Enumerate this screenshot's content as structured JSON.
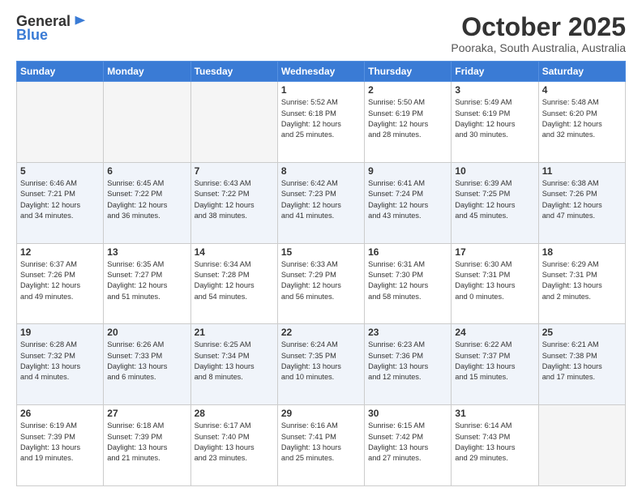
{
  "logo": {
    "general": "General",
    "blue": "Blue"
  },
  "header": {
    "month": "October 2025",
    "location": "Pooraka, South Australia, Australia"
  },
  "weekdays": [
    "Sunday",
    "Monday",
    "Tuesday",
    "Wednesday",
    "Thursday",
    "Friday",
    "Saturday"
  ],
  "weeks": [
    [
      {
        "day": "",
        "info": ""
      },
      {
        "day": "",
        "info": ""
      },
      {
        "day": "",
        "info": ""
      },
      {
        "day": "1",
        "info": "Sunrise: 5:52 AM\nSunset: 6:18 PM\nDaylight: 12 hours\nand 25 minutes."
      },
      {
        "day": "2",
        "info": "Sunrise: 5:50 AM\nSunset: 6:19 PM\nDaylight: 12 hours\nand 28 minutes."
      },
      {
        "day": "3",
        "info": "Sunrise: 5:49 AM\nSunset: 6:19 PM\nDaylight: 12 hours\nand 30 minutes."
      },
      {
        "day": "4",
        "info": "Sunrise: 5:48 AM\nSunset: 6:20 PM\nDaylight: 12 hours\nand 32 minutes."
      }
    ],
    [
      {
        "day": "5",
        "info": "Sunrise: 6:46 AM\nSunset: 7:21 PM\nDaylight: 12 hours\nand 34 minutes."
      },
      {
        "day": "6",
        "info": "Sunrise: 6:45 AM\nSunset: 7:22 PM\nDaylight: 12 hours\nand 36 minutes."
      },
      {
        "day": "7",
        "info": "Sunrise: 6:43 AM\nSunset: 7:22 PM\nDaylight: 12 hours\nand 38 minutes."
      },
      {
        "day": "8",
        "info": "Sunrise: 6:42 AM\nSunset: 7:23 PM\nDaylight: 12 hours\nand 41 minutes."
      },
      {
        "day": "9",
        "info": "Sunrise: 6:41 AM\nSunset: 7:24 PM\nDaylight: 12 hours\nand 43 minutes."
      },
      {
        "day": "10",
        "info": "Sunrise: 6:39 AM\nSunset: 7:25 PM\nDaylight: 12 hours\nand 45 minutes."
      },
      {
        "day": "11",
        "info": "Sunrise: 6:38 AM\nSunset: 7:26 PM\nDaylight: 12 hours\nand 47 minutes."
      }
    ],
    [
      {
        "day": "12",
        "info": "Sunrise: 6:37 AM\nSunset: 7:26 PM\nDaylight: 12 hours\nand 49 minutes."
      },
      {
        "day": "13",
        "info": "Sunrise: 6:35 AM\nSunset: 7:27 PM\nDaylight: 12 hours\nand 51 minutes."
      },
      {
        "day": "14",
        "info": "Sunrise: 6:34 AM\nSunset: 7:28 PM\nDaylight: 12 hours\nand 54 minutes."
      },
      {
        "day": "15",
        "info": "Sunrise: 6:33 AM\nSunset: 7:29 PM\nDaylight: 12 hours\nand 56 minutes."
      },
      {
        "day": "16",
        "info": "Sunrise: 6:31 AM\nSunset: 7:30 PM\nDaylight: 12 hours\nand 58 minutes."
      },
      {
        "day": "17",
        "info": "Sunrise: 6:30 AM\nSunset: 7:31 PM\nDaylight: 13 hours\nand 0 minutes."
      },
      {
        "day": "18",
        "info": "Sunrise: 6:29 AM\nSunset: 7:31 PM\nDaylight: 13 hours\nand 2 minutes."
      }
    ],
    [
      {
        "day": "19",
        "info": "Sunrise: 6:28 AM\nSunset: 7:32 PM\nDaylight: 13 hours\nand 4 minutes."
      },
      {
        "day": "20",
        "info": "Sunrise: 6:26 AM\nSunset: 7:33 PM\nDaylight: 13 hours\nand 6 minutes."
      },
      {
        "day": "21",
        "info": "Sunrise: 6:25 AM\nSunset: 7:34 PM\nDaylight: 13 hours\nand 8 minutes."
      },
      {
        "day": "22",
        "info": "Sunrise: 6:24 AM\nSunset: 7:35 PM\nDaylight: 13 hours\nand 10 minutes."
      },
      {
        "day": "23",
        "info": "Sunrise: 6:23 AM\nSunset: 7:36 PM\nDaylight: 13 hours\nand 12 minutes."
      },
      {
        "day": "24",
        "info": "Sunrise: 6:22 AM\nSunset: 7:37 PM\nDaylight: 13 hours\nand 15 minutes."
      },
      {
        "day": "25",
        "info": "Sunrise: 6:21 AM\nSunset: 7:38 PM\nDaylight: 13 hours\nand 17 minutes."
      }
    ],
    [
      {
        "day": "26",
        "info": "Sunrise: 6:19 AM\nSunset: 7:39 PM\nDaylight: 13 hours\nand 19 minutes."
      },
      {
        "day": "27",
        "info": "Sunrise: 6:18 AM\nSunset: 7:39 PM\nDaylight: 13 hours\nand 21 minutes."
      },
      {
        "day": "28",
        "info": "Sunrise: 6:17 AM\nSunset: 7:40 PM\nDaylight: 13 hours\nand 23 minutes."
      },
      {
        "day": "29",
        "info": "Sunrise: 6:16 AM\nSunset: 7:41 PM\nDaylight: 13 hours\nand 25 minutes."
      },
      {
        "day": "30",
        "info": "Sunrise: 6:15 AM\nSunset: 7:42 PM\nDaylight: 13 hours\nand 27 minutes."
      },
      {
        "day": "31",
        "info": "Sunrise: 6:14 AM\nSunset: 7:43 PM\nDaylight: 13 hours\nand 29 minutes."
      },
      {
        "day": "",
        "info": ""
      }
    ]
  ]
}
